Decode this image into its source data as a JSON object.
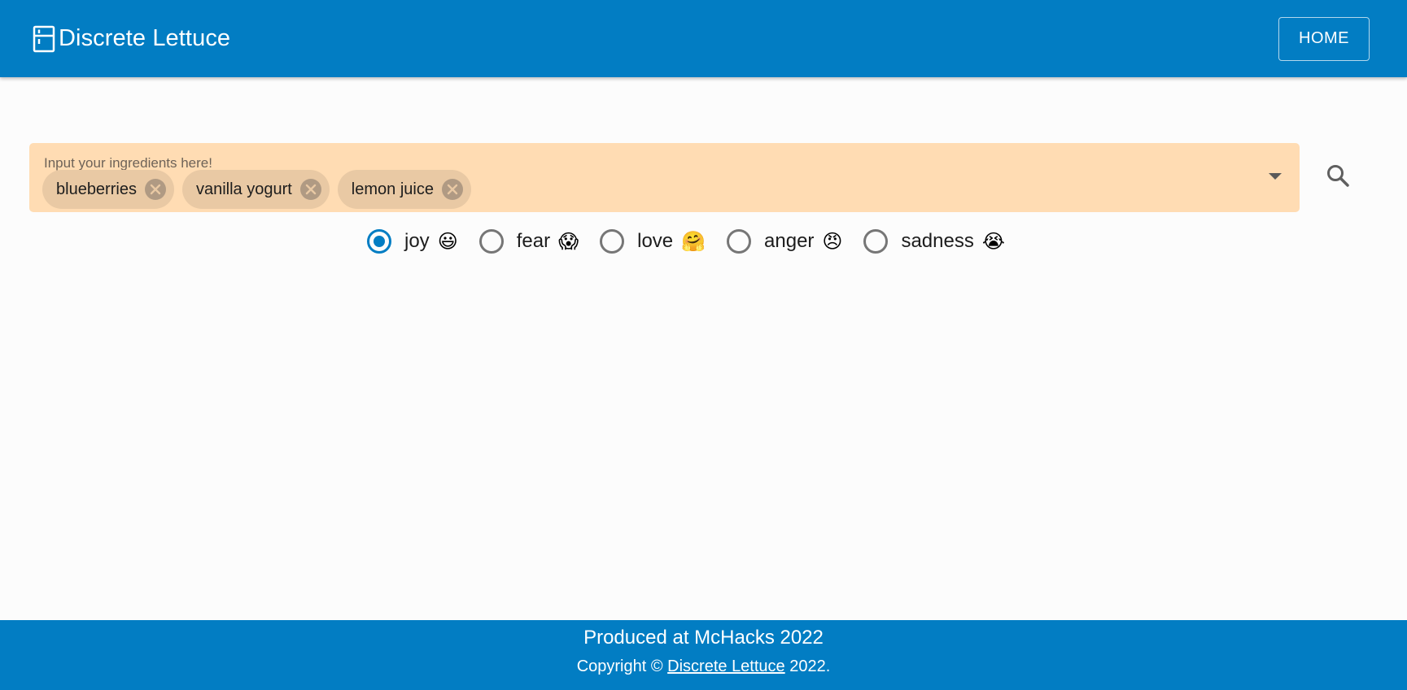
{
  "header": {
    "brand_icon": "fridge-icon",
    "title": "Discrete Lettuce",
    "home_label": "HOME"
  },
  "ingredients": {
    "label": "Input your ingredients here!",
    "chips": [
      {
        "label": "blueberries"
      },
      {
        "label": "vanilla yogurt"
      },
      {
        "label": "lemon juice"
      }
    ]
  },
  "search": {
    "icon": "search-icon"
  },
  "emotions": {
    "selected": "joy",
    "options": [
      {
        "label": "joy",
        "emoji": "😃"
      },
      {
        "label": "fear",
        "emoji": "😱"
      },
      {
        "label": "love",
        "emoji": "🤗"
      },
      {
        "label": "anger",
        "emoji": "😠"
      },
      {
        "label": "sadness",
        "emoji": "😭"
      }
    ]
  },
  "footer": {
    "line1": "Produced at McHacks 2022",
    "copyright_prefix": "Copyright ©",
    "link_text": "Discrete Lettuce",
    "copyright_suffix": "2022."
  },
  "colors": {
    "primary": "#027dc3",
    "field_background": "#ffdcb3",
    "chip_background": "#e9c9a4"
  }
}
